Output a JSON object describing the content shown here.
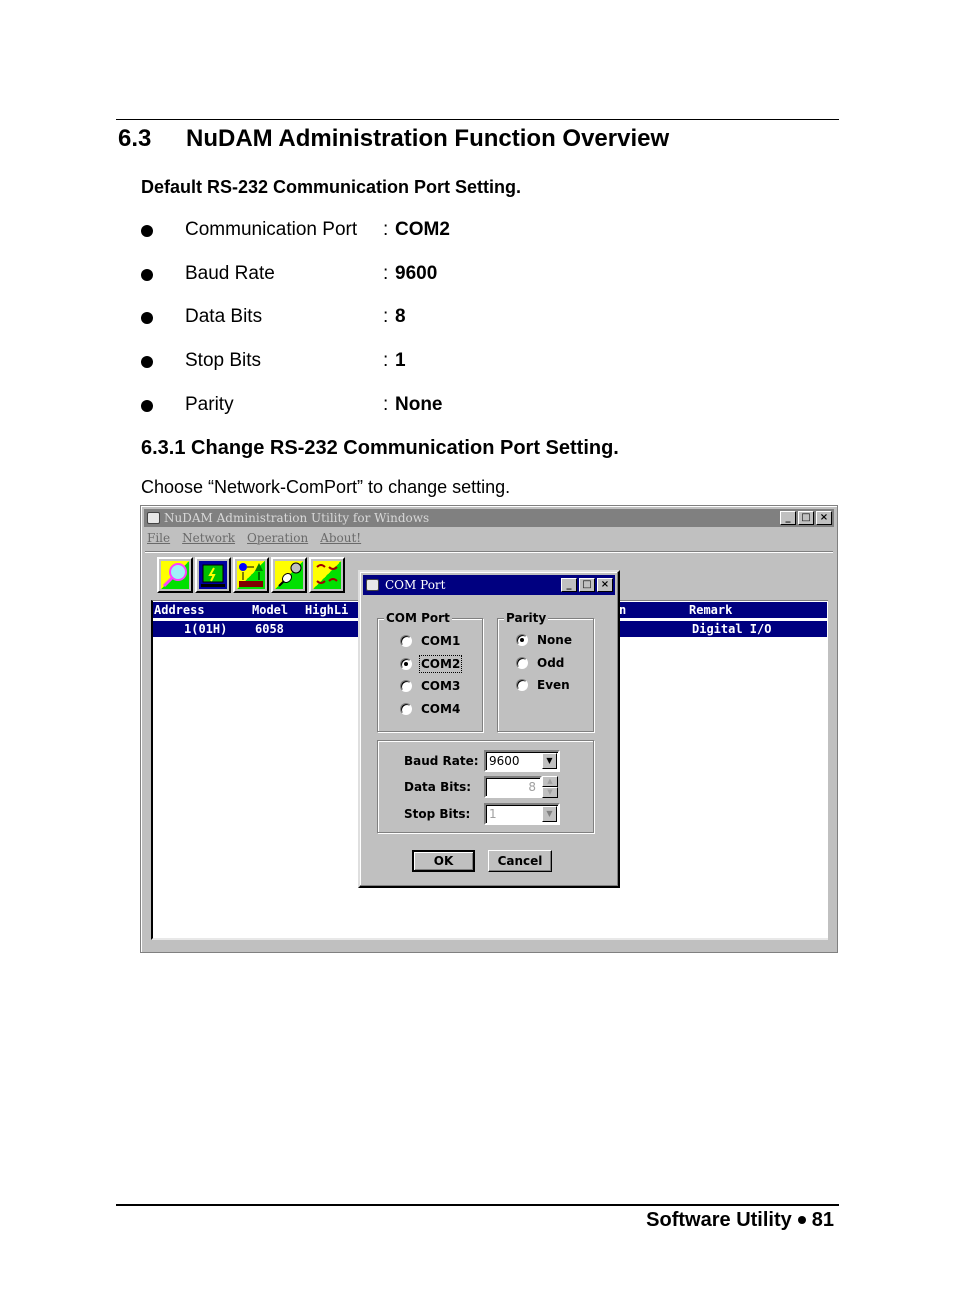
{
  "section": {
    "number": "6.3",
    "title": "NuDAM Administration Function Overview",
    "subheading": "Default RS-232 Communication Port Setting.",
    "defaults": [
      {
        "label": "Communication Port",
        "value": "COM2"
      },
      {
        "label": "Baud Rate",
        "value": "9600"
      },
      {
        "label": "Data Bits",
        "value": "8"
      },
      {
        "label": "Stop Bits",
        "value": "1"
      },
      {
        "label": "Parity",
        "value": "None"
      }
    ],
    "subsection_title": "6.3.1 Change  RS-232 Communication Port Setting.",
    "instruction": "Choose “Network-ComPort” to change setting."
  },
  "app": {
    "title": "NuDAM Administration Utility for Windows",
    "window_buttons": {
      "minimize": "_",
      "maximize": "□",
      "close": "×"
    },
    "menu": [
      "File",
      "Network",
      "Operation",
      "About!"
    ],
    "toolbar": [
      {
        "icon": "search-icon"
      },
      {
        "icon": "monitor-icon"
      },
      {
        "icon": "network-icon"
      },
      {
        "icon": "plug-icon"
      },
      {
        "icon": "arrows-icon"
      }
    ],
    "list": {
      "headers": [
        "Address",
        "Model",
        "HighLi",
        "n",
        "Remark"
      ],
      "rows": [
        {
          "address": "1(01H)",
          "model": "6058",
          "remark": "Digital I/O"
        }
      ]
    }
  },
  "dialog": {
    "title": "COM Port",
    "com_group_label": "COM Port",
    "com_options": [
      {
        "label": "COM1",
        "selected": false
      },
      {
        "label": "COM2",
        "selected": true
      },
      {
        "label": "COM3",
        "selected": false
      },
      {
        "label": "COM4",
        "selected": false
      }
    ],
    "parity_group_label": "Parity",
    "parity_options": [
      {
        "label": "None",
        "selected": true
      },
      {
        "label": "Odd",
        "selected": false
      },
      {
        "label": "Even",
        "selected": false
      }
    ],
    "baud_rate_label": "Baud Rate:",
    "baud_rate_value": "9600",
    "data_bits_label": "Data Bits:",
    "data_bits_value": "8",
    "stop_bits_label": "Stop Bits:",
    "stop_bits_value": "1",
    "ok_label": "OK",
    "cancel_label": "Cancel"
  },
  "footer": {
    "chapter": "Software Utility",
    "page": "81"
  }
}
